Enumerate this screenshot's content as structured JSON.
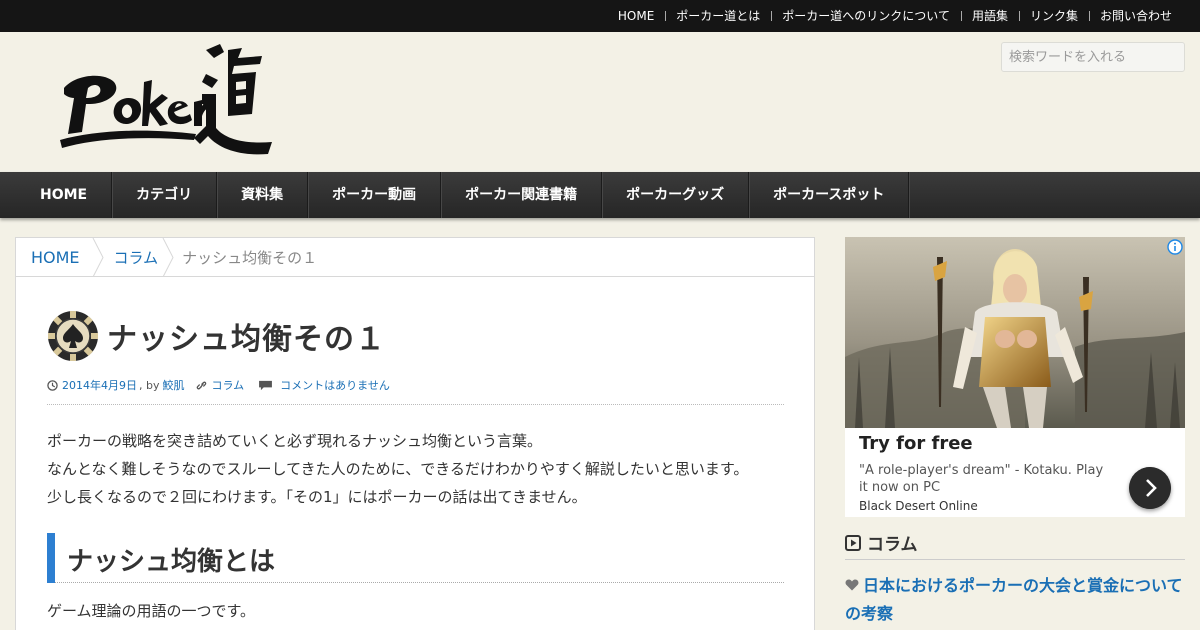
{
  "topnav": {
    "items": [
      "HOME",
      "ポーカー道とは",
      "ポーカー道へのリンクについて",
      "用語集",
      "リンク集",
      "お問い合わせ"
    ]
  },
  "header": {
    "search_placeholder": "検索ワードを入れる",
    "logo_icon": "poker-do-logo"
  },
  "mainnav": {
    "items": [
      "HOME",
      "カテゴリ",
      "資料集",
      "ポーカー動画",
      "ポーカー関連書籍",
      "ポーカーグッズ",
      "ポーカースポット"
    ]
  },
  "breadcrumb": {
    "home": "HOME",
    "category": "コラム",
    "current": "ナッシュ均衡その１"
  },
  "article": {
    "title": "ナッシュ均衡その１",
    "date": "2014年4月9日",
    "by": ", by",
    "author": "鮫肌",
    "category": "コラム",
    "comments": "コメントはありません",
    "lines": [
      "ポーカーの戦略を突き詰めていくと必ず現れるナッシュ均衡という言葉。",
      "なんとなく難しそうなのでスルーしてきた人のために、できるだけわかりやすく解説したいと思います。",
      "少し長くなるので２回にわけます。「その1」にはポーカーの話は出てきません。"
    ],
    "heading": "ナッシュ均衡とは",
    "para2": "ゲーム理論の用語の一つです。"
  },
  "ad": {
    "headline": "Try for free",
    "description": "\"A role-player's dream\" - Kotaku. Play it now on PC",
    "source": "Black Desert Online"
  },
  "sidebar": {
    "section_title": "コラム",
    "link": "日本におけるポーカーの大会と賞金についての考察"
  },
  "colors": {
    "accent": "#1a6fb5",
    "heading_bar": "#2d7fd1",
    "topbar": "#151515",
    "nav": "#2f2f2f",
    "page_bg": "#f3f1e6"
  }
}
